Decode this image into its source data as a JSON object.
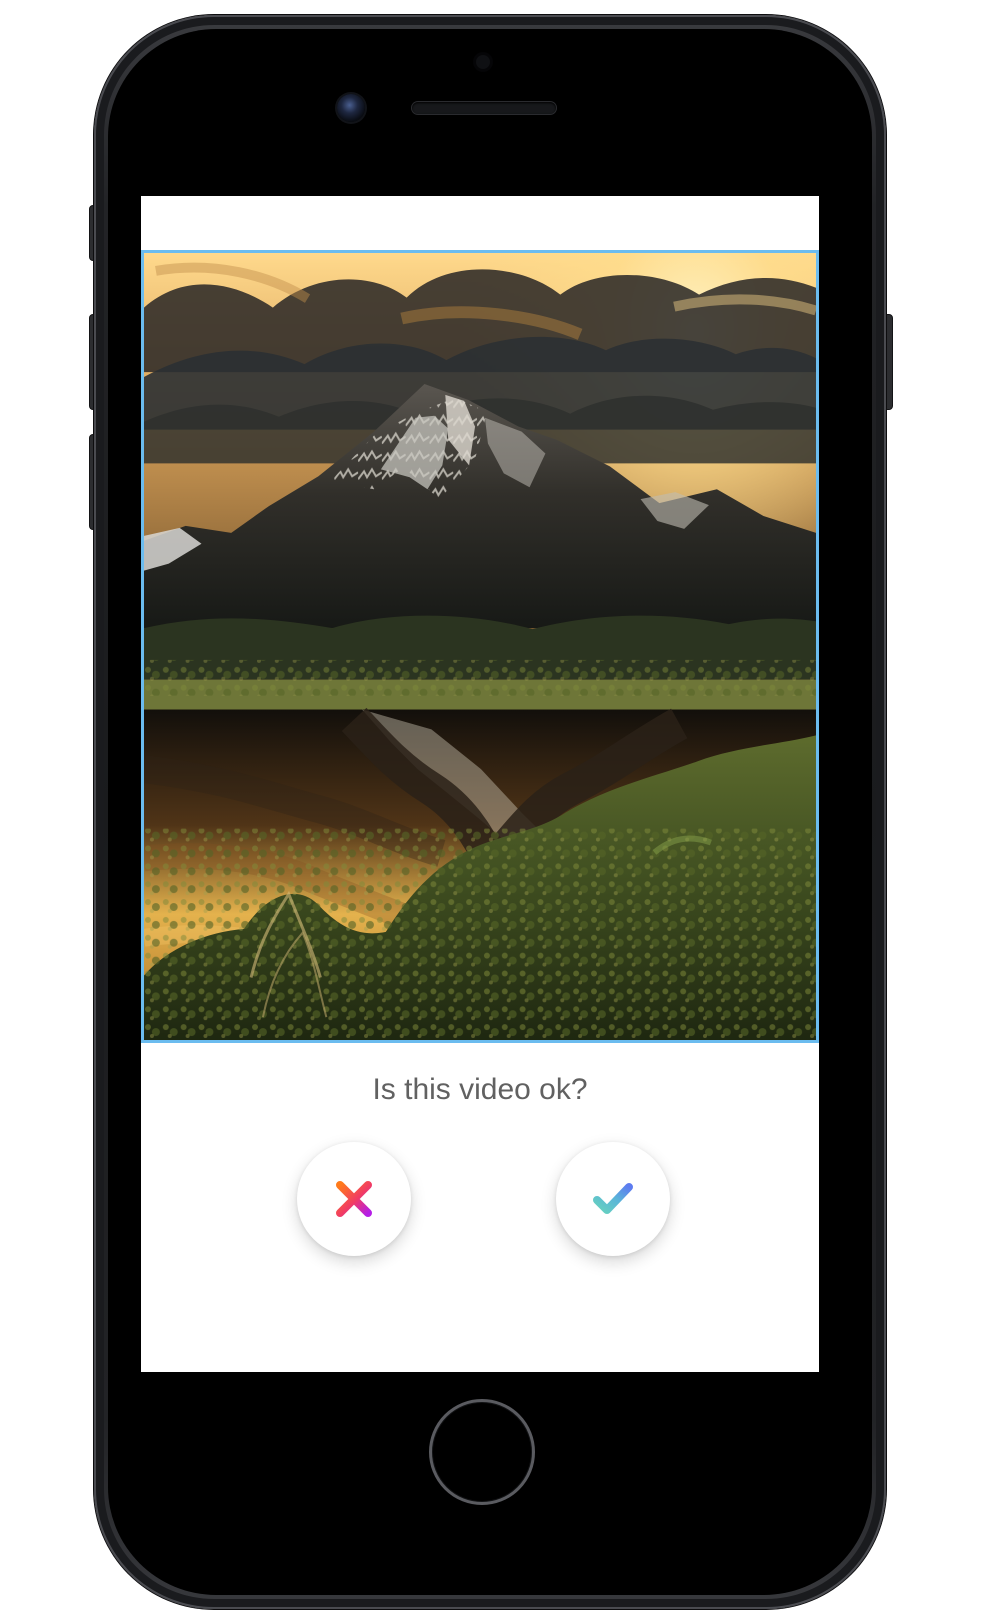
{
  "screen": {
    "video_preview": {
      "description_name": "video-preview",
      "border_color": "#6bbcef"
    },
    "prompt": {
      "text": "Is this video ok?"
    },
    "actions": {
      "reject": {
        "icon": "close-icon",
        "colors": [
          "#ff7a1a",
          "#f13b64",
          "#b51ee6"
        ]
      },
      "accept": {
        "icon": "check-icon",
        "colors": [
          "#67d2bf",
          "#5ab4d9",
          "#5d7cf0"
        ]
      }
    }
  },
  "device": {
    "type": "smartphone",
    "home_button": "home-button"
  }
}
